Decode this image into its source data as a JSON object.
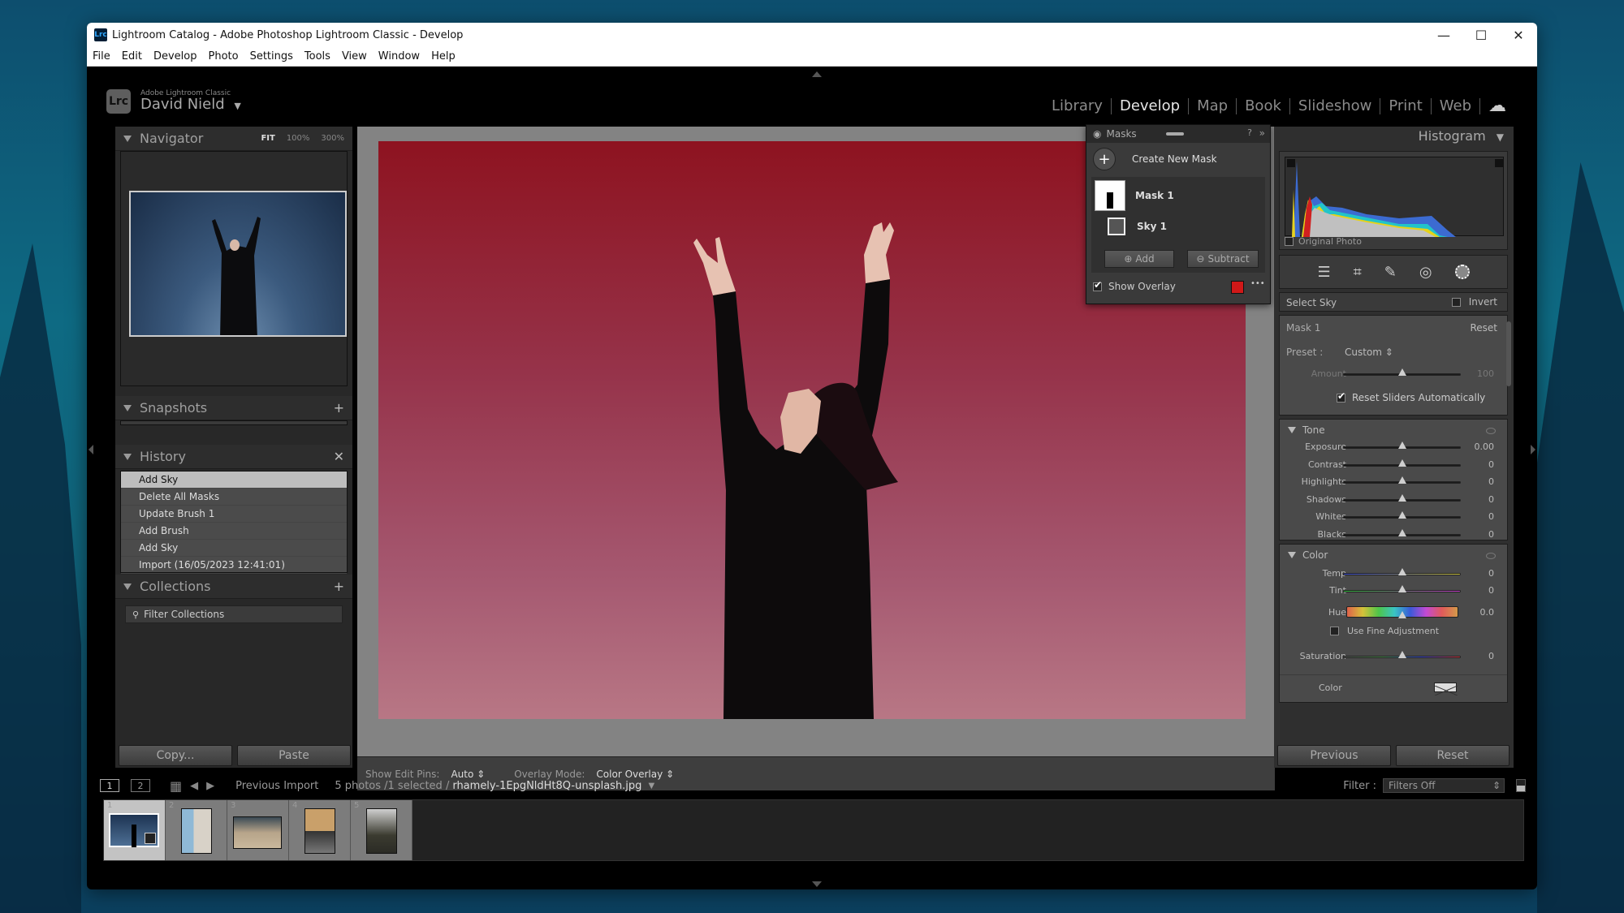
{
  "window": {
    "title": "Lightroom Catalog - Adobe Photoshop Lightroom Classic - Develop",
    "app_icon": "Lrc",
    "controls": {
      "minimize": "—",
      "maximize": "☐",
      "close": "✕"
    }
  },
  "menu": [
    "File",
    "Edit",
    "Develop",
    "Photo",
    "Settings",
    "Tools",
    "View",
    "Window",
    "Help"
  ],
  "identity": {
    "badge": "Lrc",
    "product": "Adobe Lightroom Classic",
    "user": "David Nield",
    "dropdown": "▼"
  },
  "modules": {
    "items": [
      "Library",
      "Develop",
      "Map",
      "Book",
      "Slideshow",
      "Print",
      "Web"
    ],
    "active": "Develop",
    "cloud_icon": "☁"
  },
  "left_panel": {
    "navigator": {
      "title": "Navigator",
      "zoom_options": [
        "FIT",
        "100%",
        "300%"
      ],
      "zoom_selected": "FIT"
    },
    "snapshots": {
      "title": "Snapshots",
      "action": "+"
    },
    "history": {
      "title": "History",
      "action": "✕",
      "items": [
        {
          "label": "Add Sky",
          "selected": true
        },
        {
          "label": "Delete All Masks",
          "selected": false
        },
        {
          "label": "Update Brush 1",
          "selected": false
        },
        {
          "label": "Add Brush",
          "selected": false
        },
        {
          "label": "Add Sky",
          "selected": false
        },
        {
          "label": "Import (16/05/2023 12:41:01)",
          "selected": false
        }
      ]
    },
    "collections": {
      "title": "Collections",
      "action": "+",
      "filter_placeholder": "Filter Collections"
    },
    "copy_label": "Copy...",
    "paste_label": "Paste"
  },
  "masks_panel": {
    "title": "Masks",
    "help_icon": "?",
    "collapse_icon": "»",
    "create_label": "Create New Mask",
    "mask_name": "Mask 1",
    "component_name": "Sky 1",
    "add_label": "Add",
    "subtract_label": "Subtract",
    "show_overlay_label": "Show Overlay",
    "show_overlay": true,
    "overlay_color": "#d01818",
    "more_icon": "•••"
  },
  "toolbar": {
    "edit_pins_label": "Show Edit Pins:",
    "edit_pins_value": "Auto",
    "overlay_mode_label": "Overlay Mode:",
    "overlay_mode_value": "Color Overlay"
  },
  "right_panel": {
    "histogram": {
      "title": "Histogram",
      "original_photo_label": "Original Photo"
    },
    "tools": [
      "edit-sliders",
      "crop",
      "healing",
      "red-eye",
      "masking"
    ],
    "select_sky_label": "Select Sky",
    "invert_label": "Invert",
    "mask_label": "Mask 1",
    "reset_label": "Reset",
    "preset_label": "Preset :",
    "preset_value": "Custom",
    "amount": {
      "label": "Amount",
      "value": "100",
      "position": 0.5
    },
    "reset_sliders_label": "Reset Sliders Automatically",
    "reset_sliders": true,
    "tone": {
      "title": "Tone",
      "sliders": [
        {
          "label": "Exposure",
          "value": "0.00",
          "position": 0.5
        },
        {
          "label": "Contrast",
          "value": "0",
          "position": 0.5
        },
        {
          "label": "Highlights",
          "value": "0",
          "position": 0.5
        },
        {
          "label": "Shadows",
          "value": "0",
          "position": 0.5
        },
        {
          "label": "Whites",
          "value": "0",
          "position": 0.5
        },
        {
          "label": "Blacks",
          "value": "0",
          "position": 0.5
        }
      ]
    },
    "color": {
      "title": "Color",
      "temp": {
        "label": "Temp",
        "value": "0",
        "position": 0.5
      },
      "tint": {
        "label": "Tint",
        "value": "0",
        "position": 0.5
      },
      "hue": {
        "label": "Hue",
        "value": "0.0",
        "position": 0.5
      },
      "fine_adjust_label": "Use Fine Adjustment",
      "saturation": {
        "label": "Saturation",
        "value": "0",
        "position": 0.5
      },
      "color_label": "Color"
    },
    "previous_label": "Previous",
    "reset_button_label": "Reset"
  },
  "filmstrip_bar": {
    "view1": "1",
    "view2": "2",
    "source": "Previous Import",
    "count": "5 photos /1 selected /",
    "filename": "rhamely-1EpgNldHt8Q-unsplash.jpg",
    "filter_label": "Filter :",
    "filter_value": "Filters Off"
  },
  "filmstrip": [
    {
      "index": "1",
      "selected": true
    },
    {
      "index": "2",
      "selected": false
    },
    {
      "index": "3",
      "selected": false
    },
    {
      "index": "4",
      "selected": false
    },
    {
      "index": "5",
      "selected": false
    }
  ]
}
